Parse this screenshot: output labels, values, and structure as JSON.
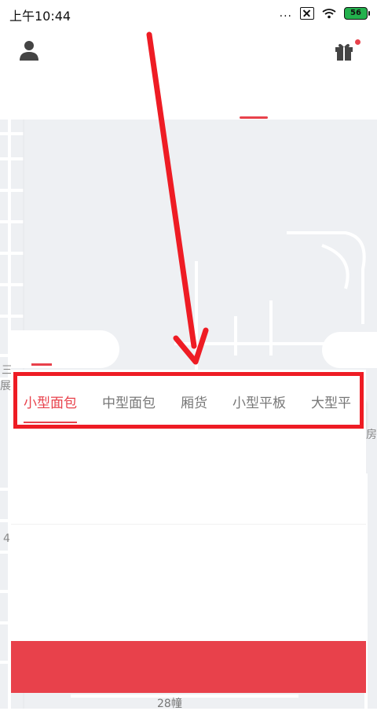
{
  "status_bar": {
    "time": "上午10:44",
    "dots": "...",
    "battery": "56"
  },
  "map": {
    "labels": {
      "left_top": "三",
      "left_mid": "展",
      "right_mid": "房",
      "left_lower": "4",
      "bottom": "28幢"
    }
  },
  "vehicle_tabs": {
    "items": [
      {
        "label": "小型面包",
        "active": true
      },
      {
        "label": "中型面包",
        "active": false
      },
      {
        "label": "厢货",
        "active": false
      },
      {
        "label": "小型平板",
        "active": false
      },
      {
        "label": "大型平",
        "active": false
      }
    ]
  },
  "colors": {
    "accent": "#e8414b",
    "highlight": "#ee1c24",
    "map_bg": "#eef0f3"
  },
  "icons": {
    "profile": "profile-icon",
    "gift": "gift-icon",
    "locate": "crosshair-icon"
  }
}
